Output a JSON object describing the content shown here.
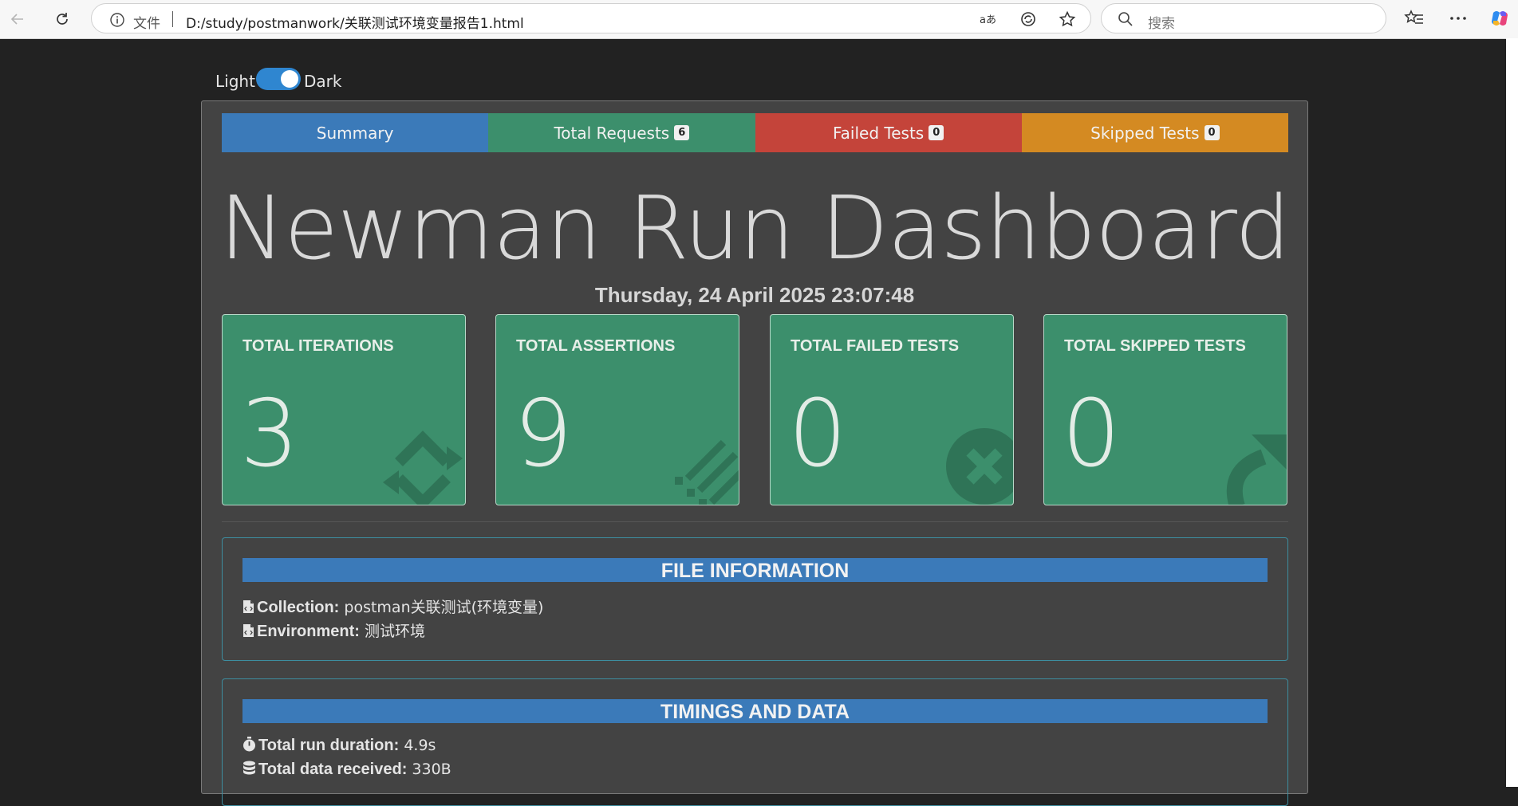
{
  "browser": {
    "address_prefix": "文件",
    "url": "D:/study/postmanwork/关联测试环境变量报告1.html",
    "search_placeholder": "搜索"
  },
  "theme_toggle": {
    "light_label": "Light",
    "dark_label": "Dark",
    "state": "dark"
  },
  "tabs": [
    {
      "label": "Summary",
      "badge": null
    },
    {
      "label": "Total Requests",
      "badge": "6"
    },
    {
      "label": "Failed Tests",
      "badge": "0"
    },
    {
      "label": "Skipped Tests",
      "badge": "0"
    }
  ],
  "dashboard": {
    "title": "Newman Run Dashboard",
    "date": "Thursday, 24 April 2025 23:07:48"
  },
  "cards": [
    {
      "title": "TOTAL ITERATIONS",
      "value": "3",
      "icon": "sync-icon"
    },
    {
      "title": "TOTAL ASSERTIONS",
      "value": "9",
      "icon": "tasks-icon"
    },
    {
      "title": "TOTAL FAILED TESTS",
      "value": "0",
      "icon": "times-circle-icon"
    },
    {
      "title": "TOTAL SKIPPED TESTS",
      "value": "0",
      "icon": "share-icon"
    }
  ],
  "file_info": {
    "header": "FILE INFORMATION",
    "collection_label": "Collection:",
    "collection_value": "postman关联测试(环境变量)",
    "environment_label": "Environment:",
    "environment_value": "测试环境"
  },
  "timings": {
    "header": "TIMINGS AND DATA",
    "duration_label": "Total run duration:",
    "duration_value": "4.9s",
    "data_label": "Total data received:",
    "data_value": "330B"
  },
  "colors": {
    "summary_tab": "#3b7ab9",
    "requests_tab": "#3c8f6c",
    "failed_tab": "#c4443a",
    "skipped_tab": "#d48a22",
    "card_bg": "#3c8f6c"
  }
}
